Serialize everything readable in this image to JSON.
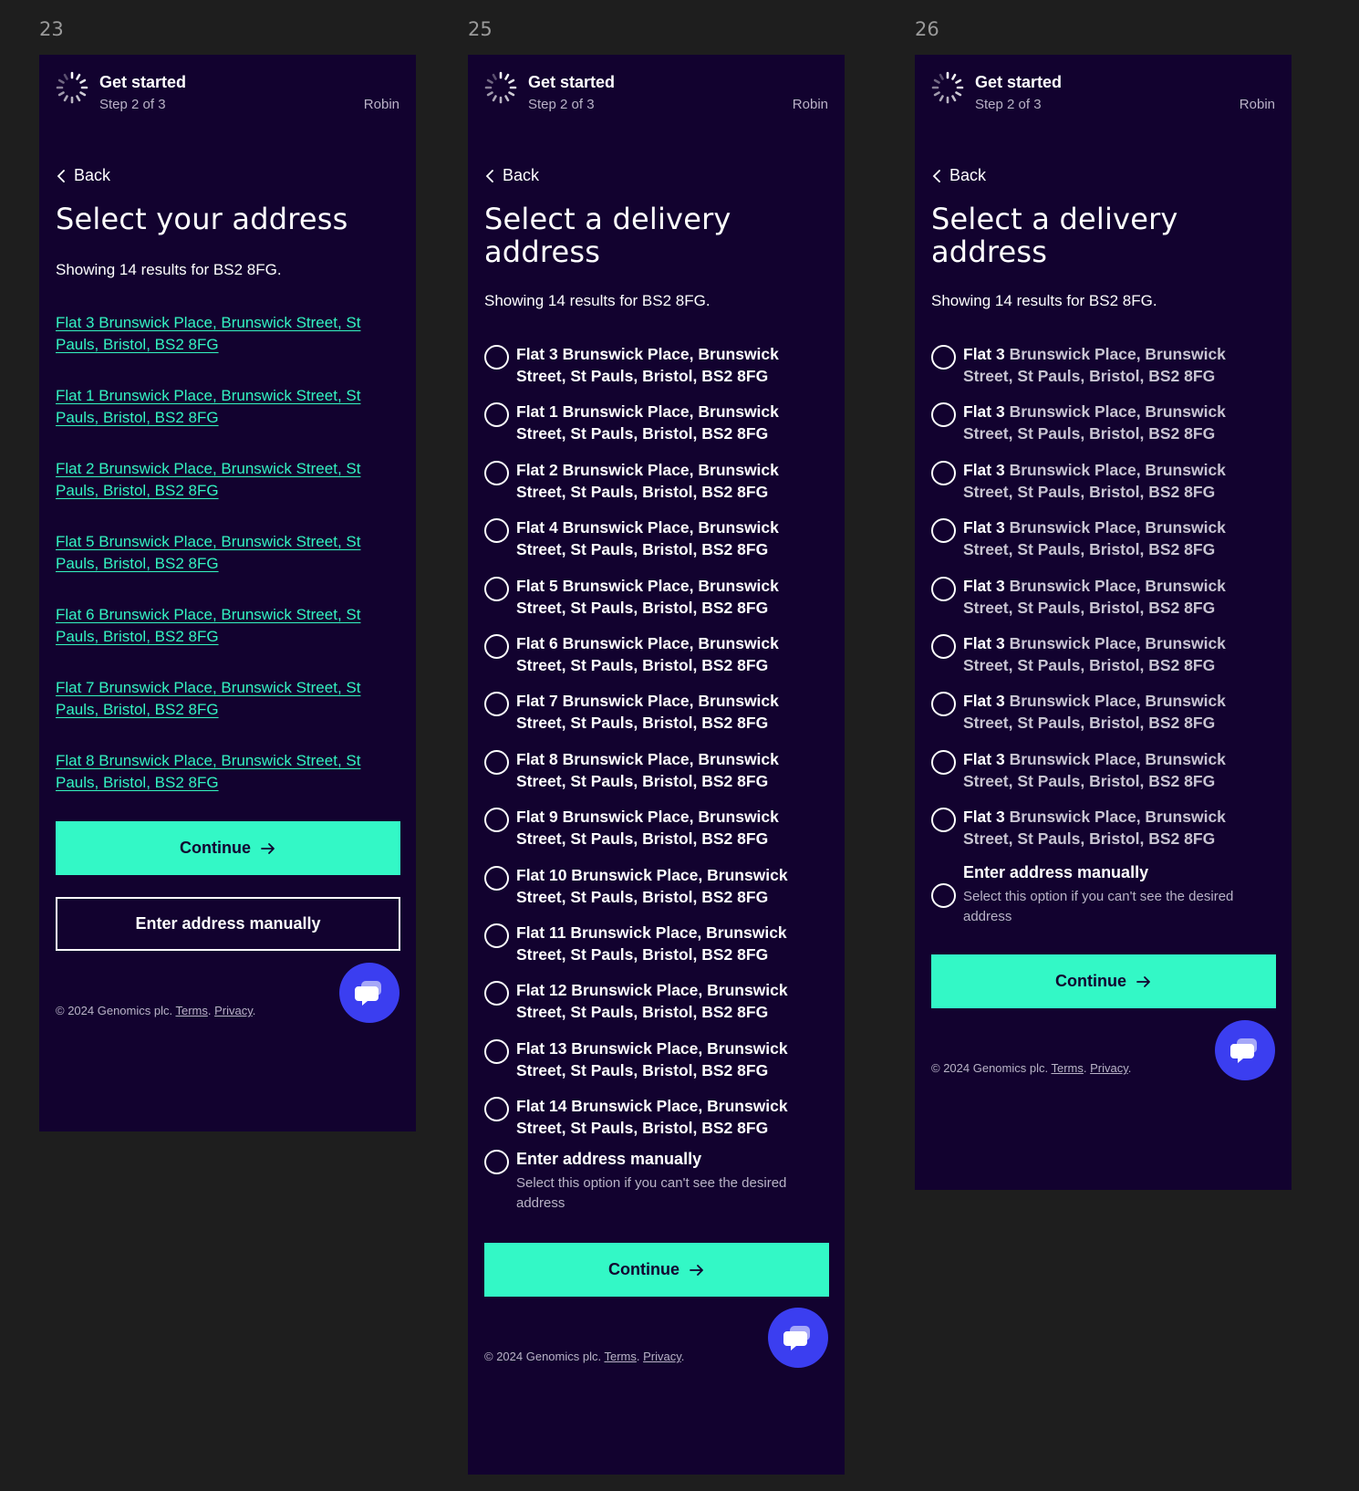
{
  "frames": [
    {
      "label": "23",
      "title": "Select your address",
      "results": "Showing 14 results for BS2 8FG."
    },
    {
      "label": "25",
      "title": "Select a delivery address",
      "results": "Showing 14 results for BS2 8FG."
    },
    {
      "label": "26",
      "title": "Select a delivery address",
      "results": "Showing 14 results for BS2 8FG."
    }
  ],
  "header": {
    "title": "Get started",
    "step": "Step 2 of 3",
    "user": "Robin"
  },
  "back_label": "Back",
  "continue_label": "Continue",
  "manual_button_label": "Enter address manually",
  "manual_option": {
    "title": "Enter address manually",
    "desc": "Select this option if you can't see the desired address"
  },
  "footer": {
    "copyright": "© 2024 Genomics plc.",
    "terms": "Terms",
    "privacy": "Privacy"
  },
  "frame23_links": [
    "Flat 3 Brunswick Place, Brunswick Street, St Pauls, Bristol, BS2 8FG",
    "Flat 1 Brunswick Place, Brunswick Street, St Pauls, Bristol, BS2 8FG",
    "Flat 2 Brunswick Place, Brunswick Street, St Pauls, Bristol, BS2 8FG",
    "Flat 5 Brunswick Place, Brunswick Street, St Pauls, Bristol, BS2 8FG",
    "Flat 6 Brunswick Place, Brunswick Street, St Pauls, Bristol, BS2 8FG",
    "Flat 7 Brunswick Place, Brunswick Street, St Pauls, Bristol, BS2 8FG",
    "Flat 8 Brunswick Place, Brunswick Street, St Pauls, Bristol, BS2 8FG"
  ],
  "frame25_options": [
    "Flat 3 Brunswick Place, Brunswick Street, St Pauls, Bristol, BS2 8FG",
    "Flat 1 Brunswick Place, Brunswick Street, St Pauls, Bristol, BS2 8FG",
    "Flat 2 Brunswick Place, Brunswick Street, St Pauls, Bristol, BS2 8FG",
    "Flat 4 Brunswick Place, Brunswick Street, St Pauls, Bristol, BS2 8FG",
    "Flat 5 Brunswick Place, Brunswick Street, St Pauls, Bristol, BS2 8FG",
    "Flat 6 Brunswick Place, Brunswick Street, St Pauls, Bristol, BS2 8FG",
    "Flat 7 Brunswick Place, Brunswick Street, St Pauls, Bristol, BS2 8FG",
    "Flat 8 Brunswick Place, Brunswick Street, St Pauls, Bristol, BS2 8FG",
    "Flat 9 Brunswick Place, Brunswick Street, St Pauls, Bristol, BS2 8FG",
    "Flat 10 Brunswick Place, Brunswick Street, St Pauls, Bristol, BS2 8FG",
    "Flat 11 Brunswick Place, Brunswick Street, St Pauls, Bristol, BS2 8FG",
    "Flat 12 Brunswick Place, Brunswick Street, St Pauls, Bristol, BS2 8FG",
    "Flat 13 Brunswick Place, Brunswick Street, St Pauls, Bristol, BS2 8FG",
    "Flat 14 Brunswick Place, Brunswick Street, St Pauls, Bristol, BS2 8FG"
  ],
  "frame26_options": [
    {
      "flat": "Flat 3",
      "rest": "Brunswick Place, Brunswick Street, St Pauls, Bristol, BS2 8FG"
    },
    {
      "flat": "Flat 3",
      "rest": "Brunswick Place, Brunswick Street, St Pauls, Bristol, BS2 8FG"
    },
    {
      "flat": "Flat 3",
      "rest": "Brunswick Place, Brunswick Street, St Pauls, Bristol, BS2 8FG"
    },
    {
      "flat": "Flat 3",
      "rest": "Brunswick Place, Brunswick Street, St Pauls, Bristol, BS2 8FG"
    },
    {
      "flat": "Flat 3",
      "rest": "Brunswick Place, Brunswick Street, St Pauls, Bristol, BS2 8FG"
    },
    {
      "flat": "Flat 3",
      "rest": "Brunswick Place, Brunswick Street, St Pauls, Bristol, BS2 8FG"
    },
    {
      "flat": "Flat 3",
      "rest": "Brunswick Place, Brunswick Street, St Pauls, Bristol, BS2 8FG"
    },
    {
      "flat": "Flat 3",
      "rest": "Brunswick Place, Brunswick Street, St Pauls, Bristol, BS2 8FG"
    },
    {
      "flat": "Flat 3",
      "rest": "Brunswick Place, Brunswick Street, St Pauls, Bristol, BS2 8FG"
    }
  ],
  "colors": {
    "background": "#1e1e1e",
    "panel": "#12022f",
    "accent": "#33f8c6",
    "link": "#33f5c2",
    "chat": "#3b3ef0"
  },
  "icons": [
    "spinner-icon",
    "chevron-left-icon",
    "arrow-right-icon",
    "chat-icon"
  ]
}
